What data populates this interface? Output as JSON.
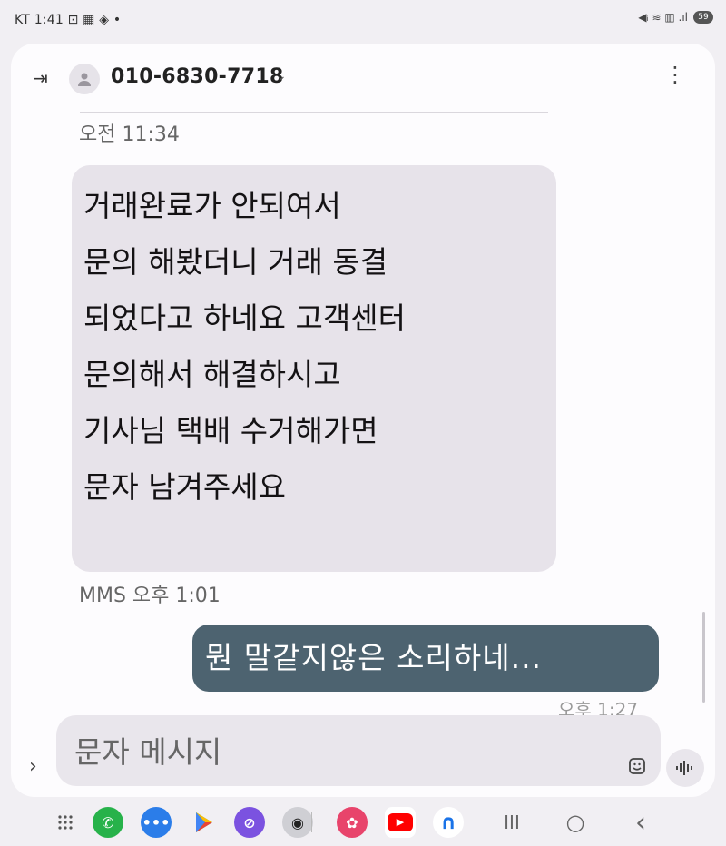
{
  "status_bar": {
    "left_text": "KT 1:41 ⊡ ▦ ◈ •",
    "right_text": "◀ᵢ ≋ ▥ .ıl",
    "battery": "59"
  },
  "header": {
    "back_icon": "arrow-to-right",
    "title": "010-6830-7718",
    "chevron": "⌄",
    "more": "⋮"
  },
  "messages": {
    "received_time": "오전 11:34",
    "received_lines": [
      "거래완료가 안되여서",
      "문의 해봤더니 거래 동결",
      "되었다고 하네요 고객센터",
      "문의해서 해결하시고",
      "기사님 택배 수거해가면",
      "문자 남겨주세요"
    ],
    "mms_time": "MMS 오후 1:01",
    "sent_text": "뭔  말같지않은  소리하네...",
    "sent_time": "오후 1:27"
  },
  "composer": {
    "placeholder": "문자 메시지",
    "expand_icon": "›"
  },
  "nav": {
    "recents": "III",
    "home": "○",
    "back": "‹"
  }
}
